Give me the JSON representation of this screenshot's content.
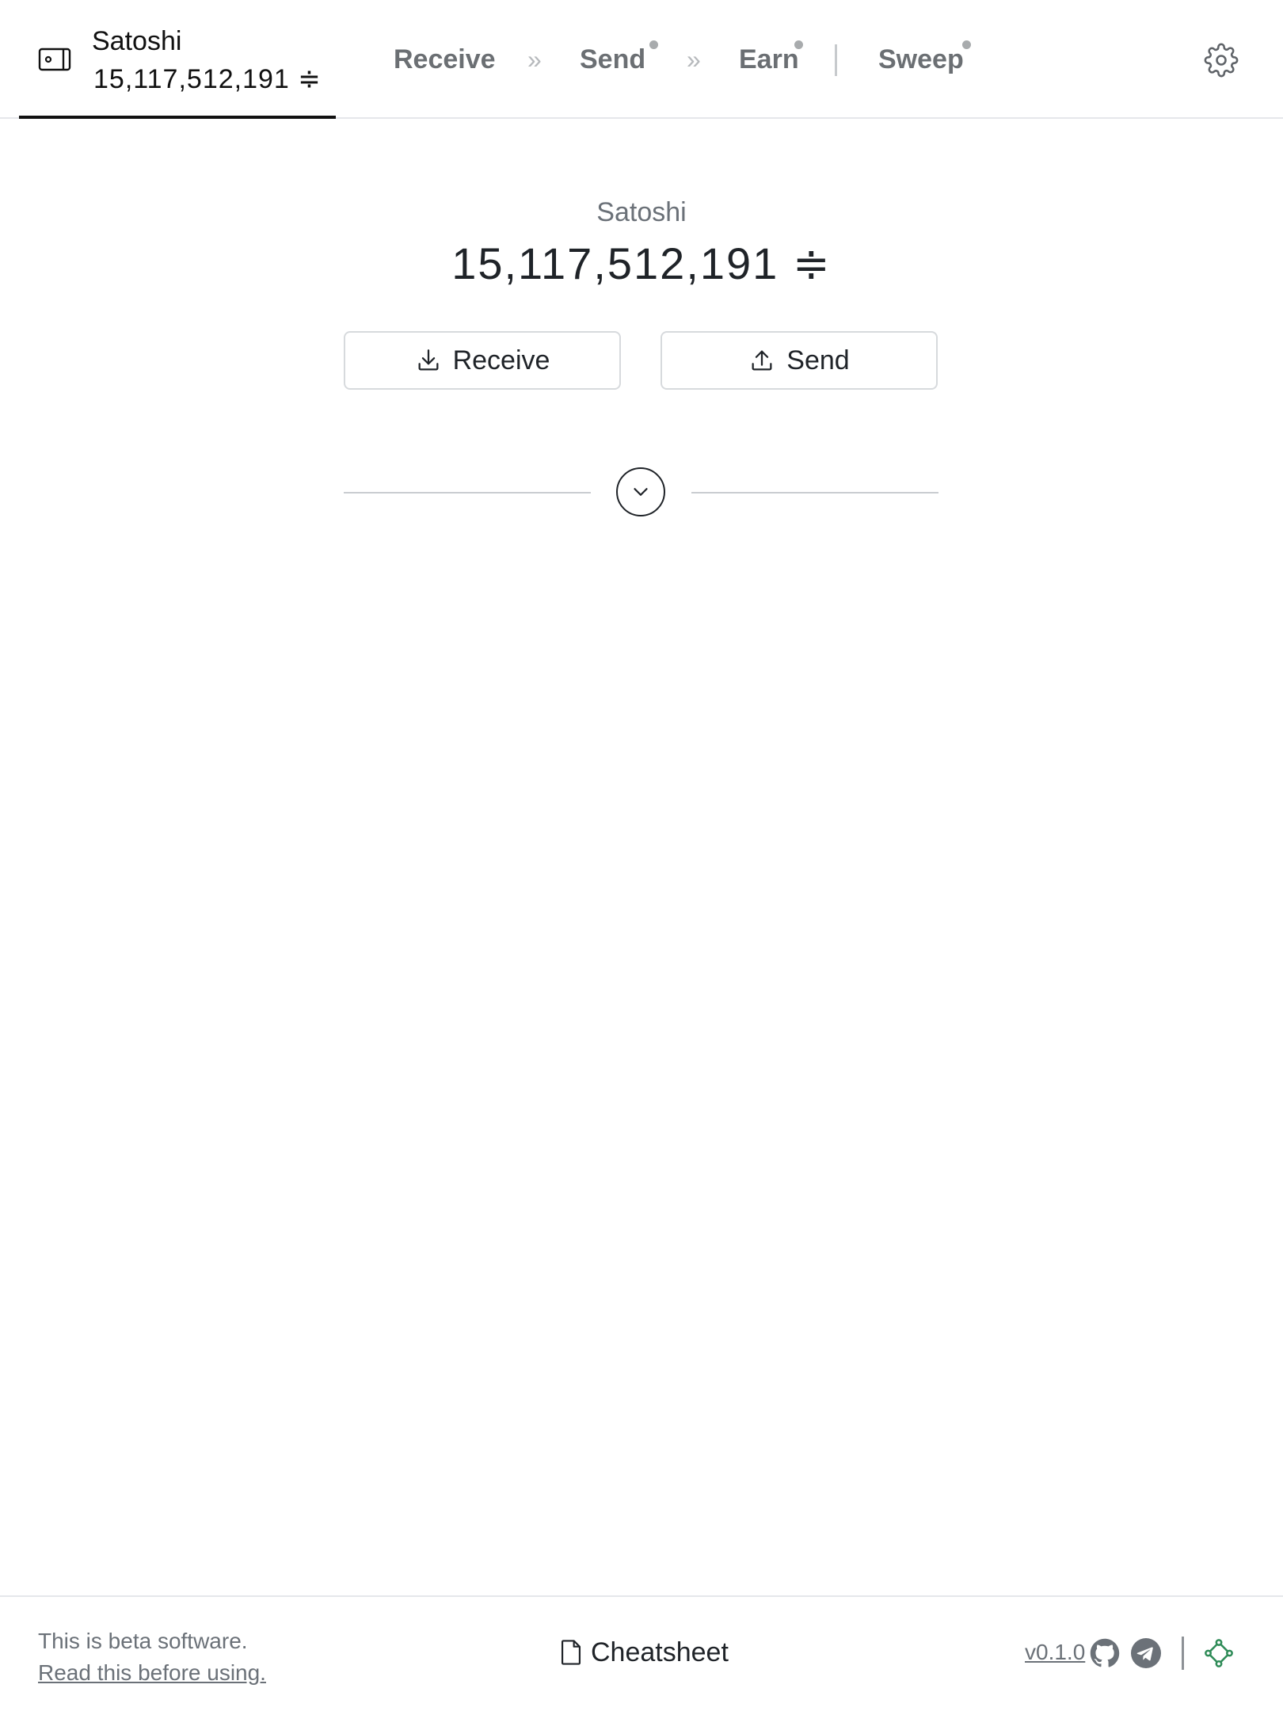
{
  "header": {
    "wallet": {
      "name": "Satoshi",
      "balance": "15,117,512,191 ≑",
      "icon": "wallet-icon"
    },
    "nav": {
      "receive": "Receive",
      "send": "Send",
      "earn": "Earn",
      "sweep": "Sweep",
      "chevron": "»"
    },
    "settings_icon": "gear-icon"
  },
  "main": {
    "wallet_label": "Satoshi",
    "balance": "15,117,512,191 ≑",
    "receive_button": "Receive",
    "send_button": "Send",
    "expand_icon": "chevron-down-icon"
  },
  "footer": {
    "beta_text": "This is beta software.",
    "beta_link": "Read this before using.",
    "cheatsheet": "Cheatsheet",
    "version": "v0.1.0",
    "icons": [
      "github-icon",
      "telegram-icon",
      "network-icon"
    ]
  },
  "colors": {
    "text": "#1f2328",
    "muted": "#6b7178",
    "nav": "#6b6f73",
    "border": "#d7dadd",
    "accent_green": "#2e8b57"
  }
}
